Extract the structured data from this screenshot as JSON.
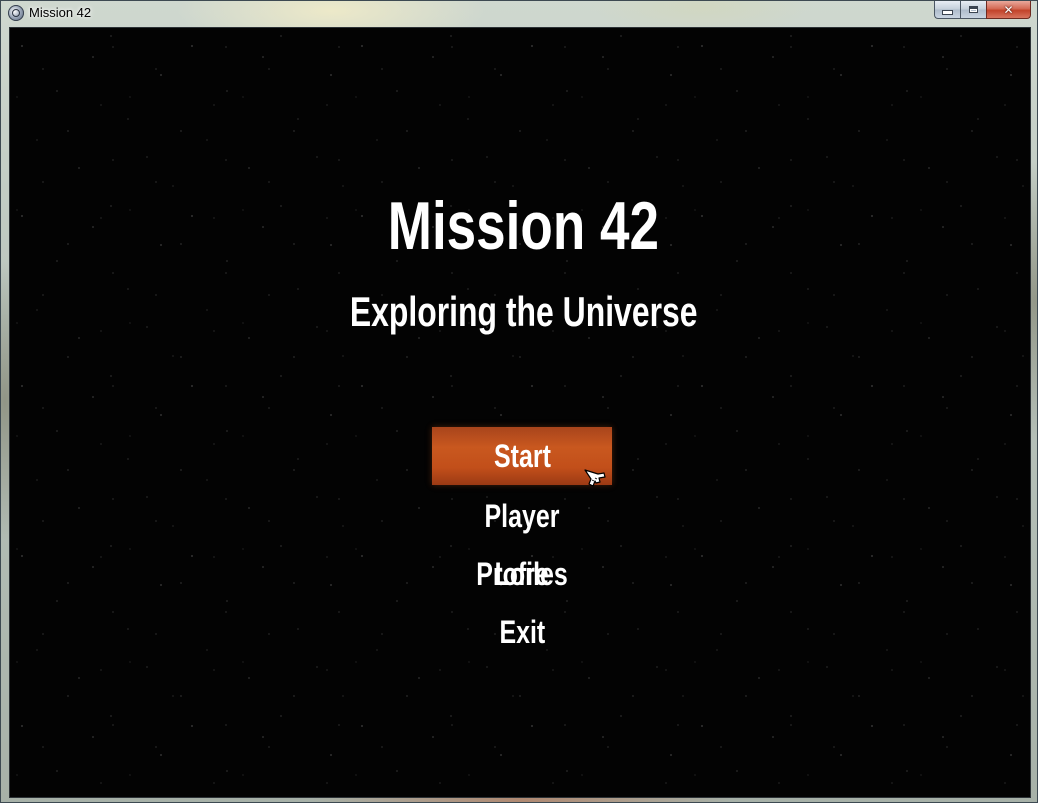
{
  "window": {
    "title": "Mission 42",
    "icon": "app-globe-icon"
  },
  "game": {
    "title": "Mission 42",
    "subtitle": "Exploring the Universe"
  },
  "menu": {
    "items": [
      {
        "label": "Start",
        "selected": true
      },
      {
        "label": "Player Profiles",
        "selected": false
      },
      {
        "label": "Lore",
        "selected": false
      },
      {
        "label": "Exit",
        "selected": false
      }
    ],
    "highlight_color": "#c24f1a"
  },
  "cursor": {
    "icon": "hand-pointer-icon"
  }
}
